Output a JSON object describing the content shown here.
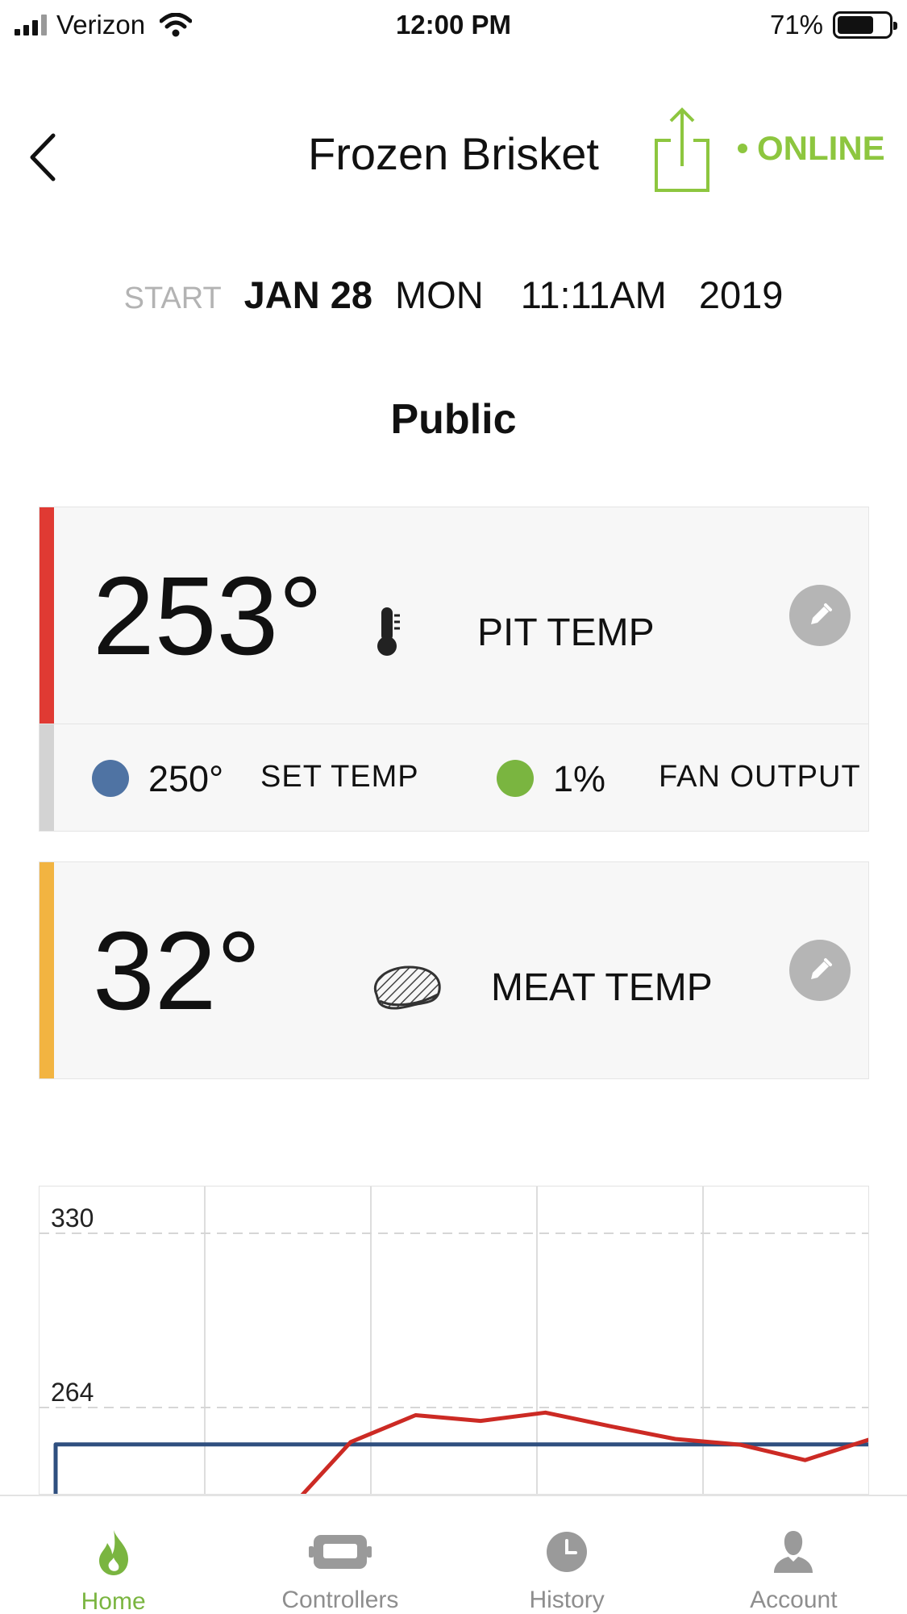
{
  "status_bar": {
    "carrier": "Verizon",
    "time": "12:00 PM",
    "battery": "71%",
    "battery_level": 0.71
  },
  "header": {
    "title": "Frozen Brisket",
    "status": "ONLINE",
    "status_color": "#8dc63f"
  },
  "start": {
    "label": "START",
    "date": "JAN 28",
    "day": "MON",
    "time": "11:11AM",
    "year": "2019"
  },
  "visibility": "Public",
  "pit_card": {
    "value": "253°",
    "label": "PIT TEMP",
    "accent": "#e03a33",
    "icon": "thermometer-icon"
  },
  "sub_row": {
    "set_temp_value": "250°",
    "set_temp_label": "SET TEMP",
    "set_color": "#4f73a3",
    "fan_value": "1%",
    "fan_label": "FAN OUTPUT",
    "fan_color": "#7ab540"
  },
  "meat_card": {
    "value": "32°",
    "label": "MEAT TEMP",
    "accent": "#f2b441",
    "icon": "steak-icon"
  },
  "chart_data": {
    "type": "line",
    "y_ticks": [
      "330",
      "264"
    ],
    "grid": true,
    "series": [
      {
        "color": "#2f4f7f",
        "values": [
          250,
          250,
          250,
          250,
          250,
          250,
          250,
          250,
          250,
          250,
          250
        ]
      },
      {
        "color": "#cc2a24",
        "values": [
          205,
          225,
          250,
          262,
          258,
          263,
          256,
          253,
          249,
          245,
          251
        ]
      }
    ]
  },
  "tabs": [
    {
      "label": "Home",
      "icon": "flame-icon",
      "active": true
    },
    {
      "label": "Controllers",
      "icon": "controller-icon",
      "active": false
    },
    {
      "label": "History",
      "icon": "clock-icon",
      "active": false
    },
    {
      "label": "Account",
      "icon": "person-icon",
      "active": false
    }
  ]
}
